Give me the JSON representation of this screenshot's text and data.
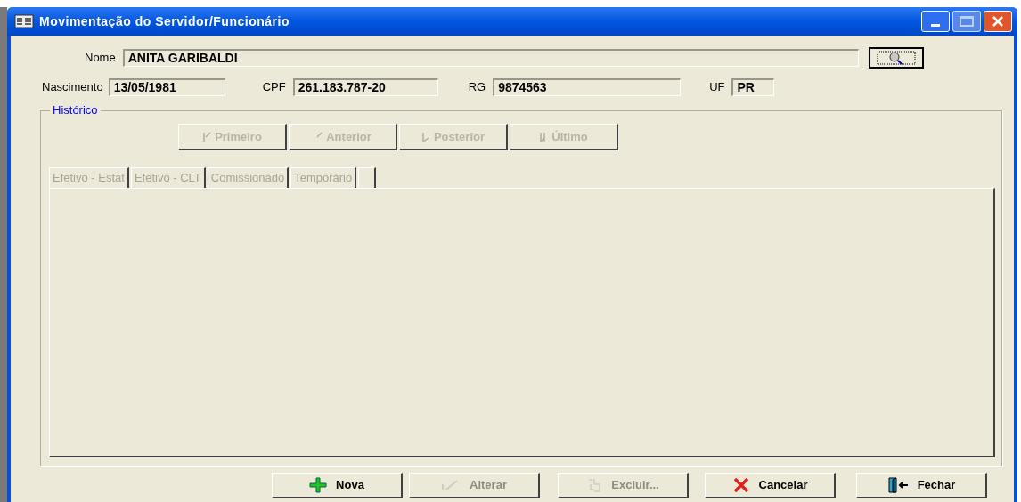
{
  "window": {
    "title": "Movimentação do Servidor/Funcionário"
  },
  "fields": [
    {
      "label": "Nome",
      "value": "ANITA GARIBALDI"
    },
    {
      "label": "Nascimento",
      "value": "13/05/1981"
    },
    {
      "label": "CPF",
      "value": "261.183.787-20"
    },
    {
      "label": "RG",
      "value": "9874563"
    },
    {
      "label": "UF",
      "value": "PR"
    }
  ],
  "historico": {
    "title": "Histórico",
    "nav_buttons": [
      {
        "kind": "first",
        "label": "Primeiro",
        "disabled": true
      },
      {
        "kind": "prev",
        "label": "Anterior",
        "disabled": true
      },
      {
        "kind": "next",
        "label": "Posterior",
        "disabled": true
      },
      {
        "kind": "last",
        "label": "Último",
        "disabled": true
      }
    ],
    "tabs": [
      {
        "label": "Efetivo - Estat",
        "disabled": true
      },
      {
        "label": "Efetivo - CLT",
        "disabled": true
      },
      {
        "label": "Comissionado",
        "disabled": true
      },
      {
        "label": "Temporário",
        "disabled": true
      }
    ]
  },
  "buttons": [
    {
      "kind": "new",
      "label": "Nova",
      "disabled": false
    },
    {
      "kind": "edit",
      "label": "Alterar",
      "disabled": true
    },
    {
      "kind": "delete",
      "label": "Excluir...",
      "disabled": true
    },
    {
      "kind": "cancel",
      "label": "Cancelar",
      "disabled": false
    },
    {
      "kind": "close",
      "label": "Fechar",
      "disabled": false
    }
  ]
}
